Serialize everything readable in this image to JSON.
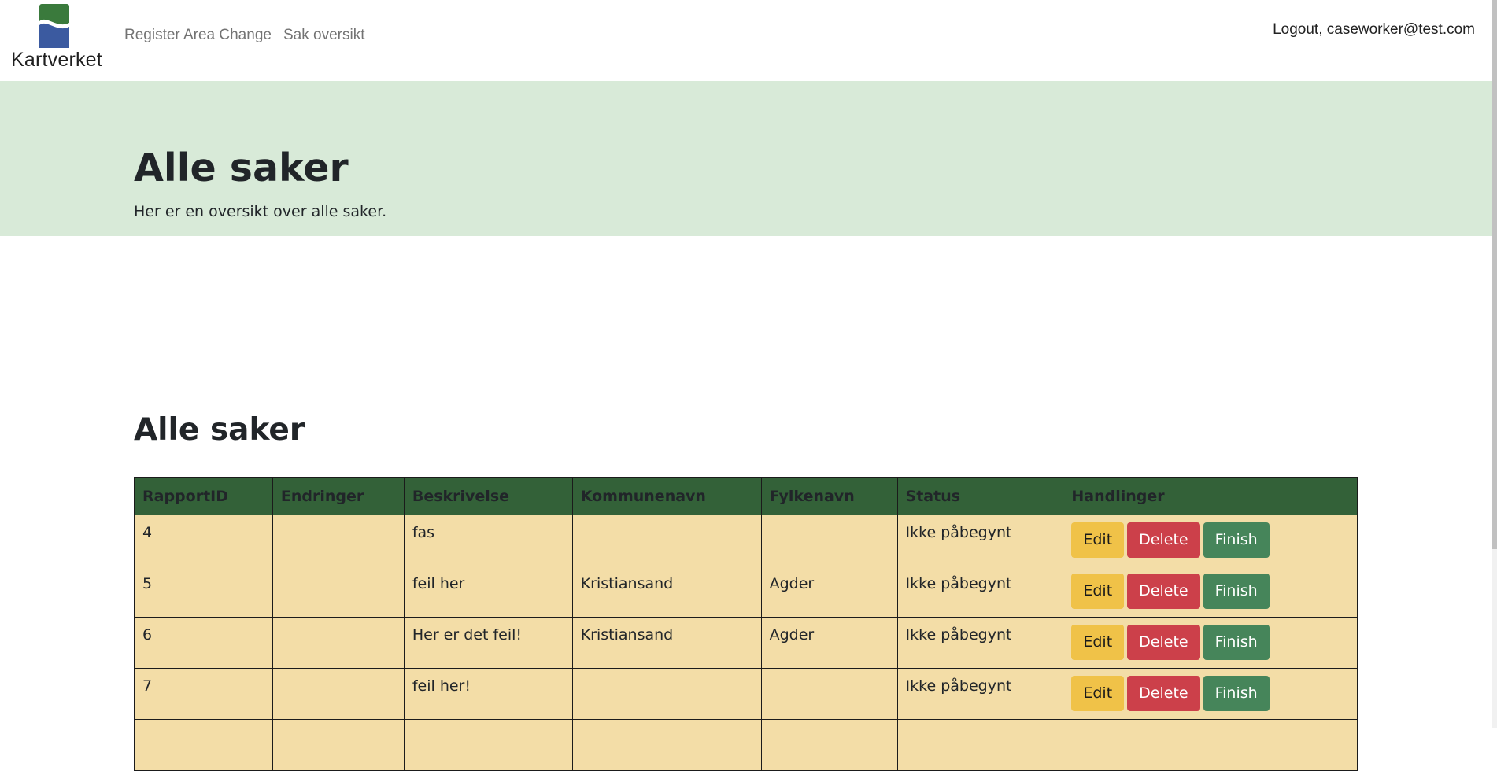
{
  "brand": {
    "name": "Kartverket",
    "logo_icon": "kartverket-wave-logo"
  },
  "nav": {
    "links": [
      {
        "label": "Register Area Change"
      },
      {
        "label": "Sak oversikt"
      }
    ],
    "logout_label": "Logout, caseworker@test.com"
  },
  "hero": {
    "title": "Alle saker",
    "subtitle": "Her er en oversikt over alle saker."
  },
  "cases": {
    "title": "Alle saker",
    "columns": [
      "RapportID",
      "Endringer",
      "Beskrivelse",
      "Kommunenavn",
      "Fylkenavn",
      "Status",
      "Handlinger"
    ],
    "rows": [
      {
        "id": "4",
        "endringer": "",
        "beskrivelse": "fas",
        "kommune": "",
        "fylke": "",
        "status": "Ikke påbegynt"
      },
      {
        "id": "5",
        "endringer": "",
        "beskrivelse": "feil her",
        "kommune": "Kristiansand",
        "fylke": "Agder",
        "status": "Ikke påbegynt"
      },
      {
        "id": "6",
        "endringer": "",
        "beskrivelse": "Her er det feil!",
        "kommune": "Kristiansand",
        "fylke": "Agder",
        "status": "Ikke påbegynt"
      },
      {
        "id": "7",
        "endringer": "",
        "beskrivelse": "feil her!",
        "kommune": "",
        "fylke": "",
        "status": "Ikke påbegynt"
      },
      {
        "id": "",
        "endringer": "",
        "beskrivelse": "",
        "kommune": "",
        "fylke": "",
        "status": ""
      }
    ],
    "actions": {
      "edit": "Edit",
      "delete": "Delete",
      "finish": "Finish"
    }
  },
  "colors": {
    "hero_bg": "#d8ead8",
    "table_header_bg": "#336138",
    "table_row_bg": "#f3dda7",
    "edit": "#f0c248",
    "delete": "#cc404a",
    "finish": "#46855a",
    "logo_green": "#3a7a3c",
    "logo_blue": "#3b5aa0"
  }
}
